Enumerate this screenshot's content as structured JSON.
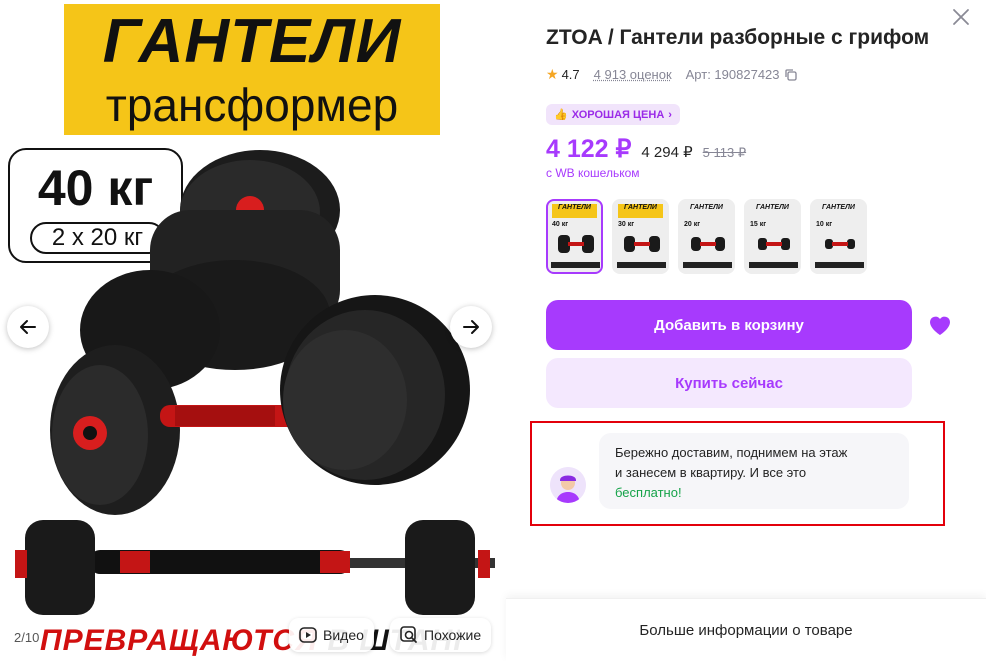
{
  "gallery": {
    "banner_title": "ГАНТЕЛИ",
    "banner_subtitle": "трансформер",
    "weight_main": "40 кг",
    "weight_sub": "2 х 20 кг",
    "bottom_caption_a": "ПРЕВРАЩАЮТСЯ ",
    "bottom_caption_b": "В ШТАНГУ",
    "slide_counter": "2/10",
    "video_label": "Видео",
    "similar_label": "Похожие"
  },
  "product": {
    "title": "ZTOA / Гантели разборные с грифом",
    "rating": "4.7",
    "reviews": "4 913 оценок",
    "article": "Арт: 190827423",
    "badge": "ХОРОШАЯ ЦЕНА",
    "price_main": "4 122 ₽",
    "price_mid": "4 294 ₽",
    "price_old": "5 113 ₽",
    "wallet_note": "с WB кошельком",
    "thumbnails": [
      {
        "title": "ГАНТЕЛИ",
        "weight": "40 кг"
      },
      {
        "title": "ГАНТЕЛИ",
        "weight": "30 кг"
      },
      {
        "title": "ГАНТЕЛИ",
        "weight": "20 кг"
      },
      {
        "title": "ГАНТЕЛИ",
        "weight": "15 кг"
      },
      {
        "title": "ГАНТЕЛИ",
        "weight": "10 кг"
      }
    ],
    "add_to_cart": "Добавить в корзину",
    "buy_now": "Купить сейчас",
    "delivery_line1": "Бережно доставим, поднимем на этаж",
    "delivery_line2": "и занесем в квартиру. И все это",
    "delivery_line3": "бесплатно!",
    "more_info": "Больше информации о товаре"
  },
  "colors": {
    "accent": "#a73afd",
    "accent_light": "#f4e8fe",
    "highlight_frame": "#e3000b",
    "free_text": "#16a34a",
    "banner_yellow": "#f5c518"
  },
  "icons": [
    "arrow-left-icon",
    "arrow-right-icon",
    "close-icon",
    "star-icon",
    "copy-icon",
    "thumb-up-icon",
    "chevron-right-icon",
    "heart-icon",
    "play-icon",
    "similar-search-icon"
  ]
}
